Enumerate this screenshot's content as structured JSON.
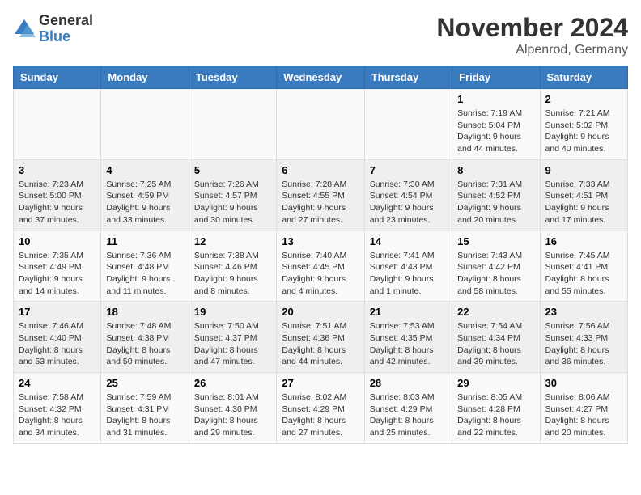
{
  "logo": {
    "general": "General",
    "blue": "Blue"
  },
  "header": {
    "month": "November 2024",
    "location": "Alpenrod, Germany"
  },
  "days_of_week": [
    "Sunday",
    "Monday",
    "Tuesday",
    "Wednesday",
    "Thursday",
    "Friday",
    "Saturday"
  ],
  "weeks": [
    [
      {
        "day": "",
        "info": ""
      },
      {
        "day": "",
        "info": ""
      },
      {
        "day": "",
        "info": ""
      },
      {
        "day": "",
        "info": ""
      },
      {
        "day": "",
        "info": ""
      },
      {
        "day": "1",
        "info": "Sunrise: 7:19 AM\nSunset: 5:04 PM\nDaylight: 9 hours and 44 minutes."
      },
      {
        "day": "2",
        "info": "Sunrise: 7:21 AM\nSunset: 5:02 PM\nDaylight: 9 hours and 40 minutes."
      }
    ],
    [
      {
        "day": "3",
        "info": "Sunrise: 7:23 AM\nSunset: 5:00 PM\nDaylight: 9 hours and 37 minutes."
      },
      {
        "day": "4",
        "info": "Sunrise: 7:25 AM\nSunset: 4:59 PM\nDaylight: 9 hours and 33 minutes."
      },
      {
        "day": "5",
        "info": "Sunrise: 7:26 AM\nSunset: 4:57 PM\nDaylight: 9 hours and 30 minutes."
      },
      {
        "day": "6",
        "info": "Sunrise: 7:28 AM\nSunset: 4:55 PM\nDaylight: 9 hours and 27 minutes."
      },
      {
        "day": "7",
        "info": "Sunrise: 7:30 AM\nSunset: 4:54 PM\nDaylight: 9 hours and 23 minutes."
      },
      {
        "day": "8",
        "info": "Sunrise: 7:31 AM\nSunset: 4:52 PM\nDaylight: 9 hours and 20 minutes."
      },
      {
        "day": "9",
        "info": "Sunrise: 7:33 AM\nSunset: 4:51 PM\nDaylight: 9 hours and 17 minutes."
      }
    ],
    [
      {
        "day": "10",
        "info": "Sunrise: 7:35 AM\nSunset: 4:49 PM\nDaylight: 9 hours and 14 minutes."
      },
      {
        "day": "11",
        "info": "Sunrise: 7:36 AM\nSunset: 4:48 PM\nDaylight: 9 hours and 11 minutes."
      },
      {
        "day": "12",
        "info": "Sunrise: 7:38 AM\nSunset: 4:46 PM\nDaylight: 9 hours and 8 minutes."
      },
      {
        "day": "13",
        "info": "Sunrise: 7:40 AM\nSunset: 4:45 PM\nDaylight: 9 hours and 4 minutes."
      },
      {
        "day": "14",
        "info": "Sunrise: 7:41 AM\nSunset: 4:43 PM\nDaylight: 9 hours and 1 minute."
      },
      {
        "day": "15",
        "info": "Sunrise: 7:43 AM\nSunset: 4:42 PM\nDaylight: 8 hours and 58 minutes."
      },
      {
        "day": "16",
        "info": "Sunrise: 7:45 AM\nSunset: 4:41 PM\nDaylight: 8 hours and 55 minutes."
      }
    ],
    [
      {
        "day": "17",
        "info": "Sunrise: 7:46 AM\nSunset: 4:40 PM\nDaylight: 8 hours and 53 minutes."
      },
      {
        "day": "18",
        "info": "Sunrise: 7:48 AM\nSunset: 4:38 PM\nDaylight: 8 hours and 50 minutes."
      },
      {
        "day": "19",
        "info": "Sunrise: 7:50 AM\nSunset: 4:37 PM\nDaylight: 8 hours and 47 minutes."
      },
      {
        "day": "20",
        "info": "Sunrise: 7:51 AM\nSunset: 4:36 PM\nDaylight: 8 hours and 44 minutes."
      },
      {
        "day": "21",
        "info": "Sunrise: 7:53 AM\nSunset: 4:35 PM\nDaylight: 8 hours and 42 minutes."
      },
      {
        "day": "22",
        "info": "Sunrise: 7:54 AM\nSunset: 4:34 PM\nDaylight: 8 hours and 39 minutes."
      },
      {
        "day": "23",
        "info": "Sunrise: 7:56 AM\nSunset: 4:33 PM\nDaylight: 8 hours and 36 minutes."
      }
    ],
    [
      {
        "day": "24",
        "info": "Sunrise: 7:58 AM\nSunset: 4:32 PM\nDaylight: 8 hours and 34 minutes."
      },
      {
        "day": "25",
        "info": "Sunrise: 7:59 AM\nSunset: 4:31 PM\nDaylight: 8 hours and 31 minutes."
      },
      {
        "day": "26",
        "info": "Sunrise: 8:01 AM\nSunset: 4:30 PM\nDaylight: 8 hours and 29 minutes."
      },
      {
        "day": "27",
        "info": "Sunrise: 8:02 AM\nSunset: 4:29 PM\nDaylight: 8 hours and 27 minutes."
      },
      {
        "day": "28",
        "info": "Sunrise: 8:03 AM\nSunset: 4:29 PM\nDaylight: 8 hours and 25 minutes."
      },
      {
        "day": "29",
        "info": "Sunrise: 8:05 AM\nSunset: 4:28 PM\nDaylight: 8 hours and 22 minutes."
      },
      {
        "day": "30",
        "info": "Sunrise: 8:06 AM\nSunset: 4:27 PM\nDaylight: 8 hours and 20 minutes."
      }
    ]
  ]
}
